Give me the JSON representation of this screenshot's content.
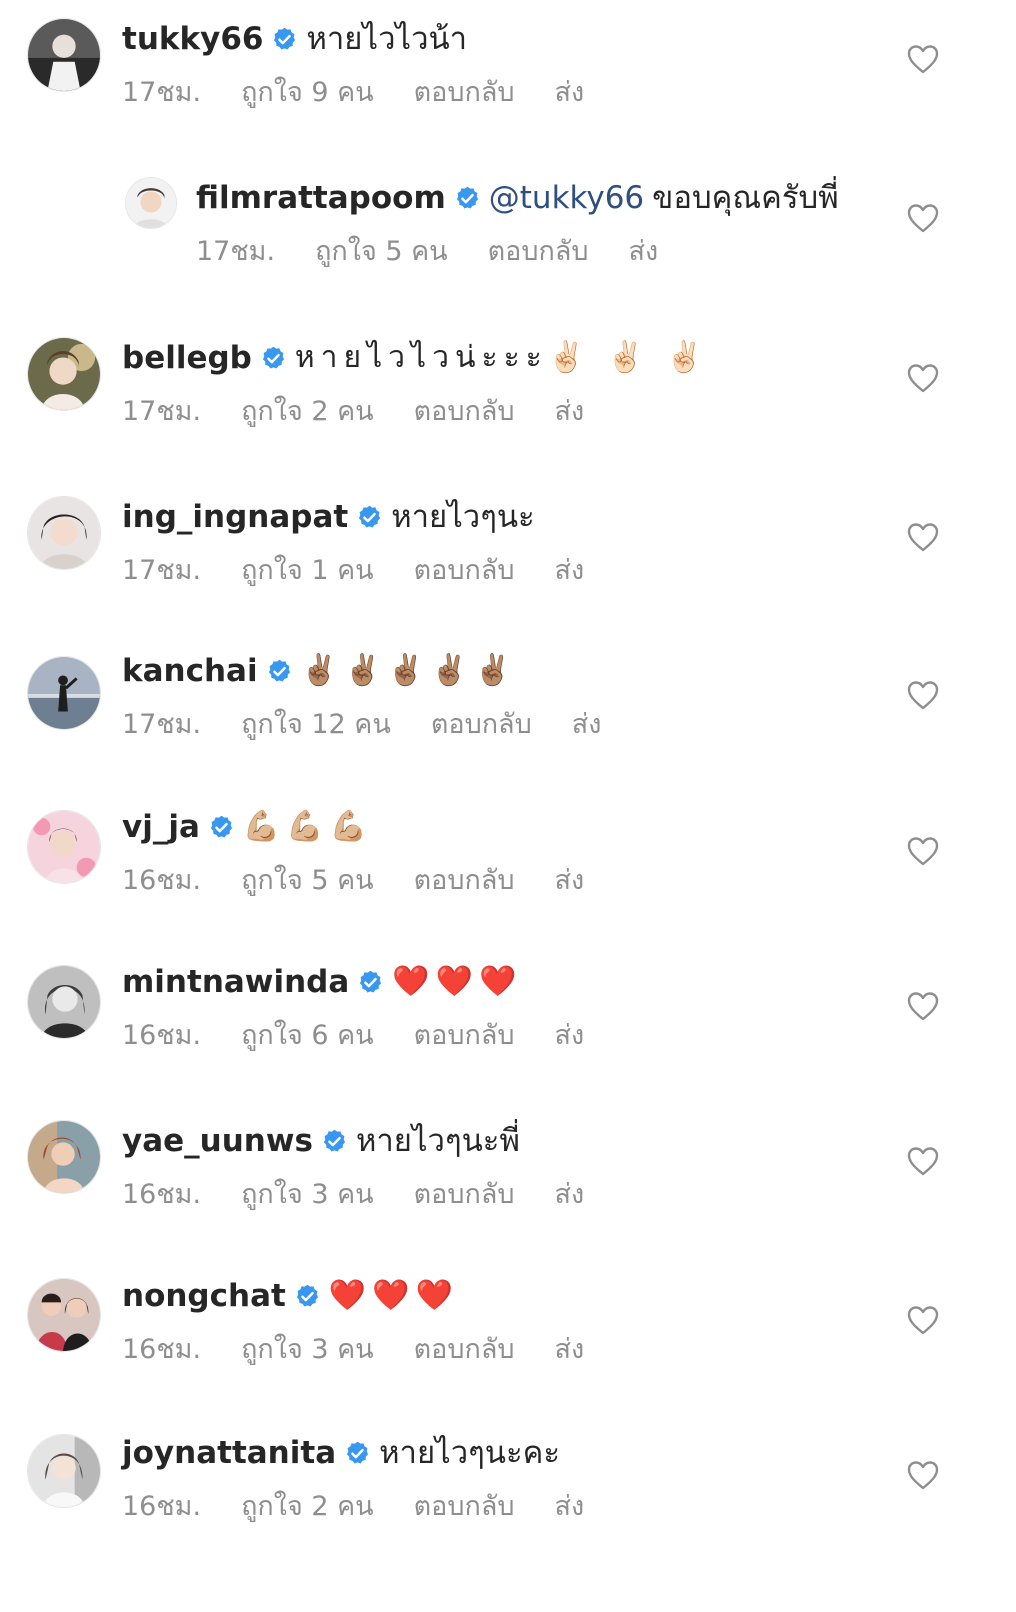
{
  "comments": [
    {
      "username": "tukky66",
      "mention": "",
      "text": "หายไวไวน้า",
      "time": "17ชม.",
      "likes": "ถูกใจ 9 คน",
      "reply": "ตอบกลับ",
      "send": "ส่ง"
    },
    {
      "username": "filmrattapoom",
      "mention": "@tukky66",
      "text": "ขอบคุณครับพี่",
      "time": "17ชม.",
      "likes": "ถูกใจ 5 คน",
      "reply": "ตอบกลับ",
      "send": "ส่ง"
    },
    {
      "username": "bellegb",
      "mention": "",
      "text": "หายไวไวน่ะะะ✌🏻 ✌🏻 ✌🏻",
      "time": "17ชม.",
      "likes": "ถูกใจ 2 คน",
      "reply": "ตอบกลับ",
      "send": "ส่ง"
    },
    {
      "username": "ing_ingnapat",
      "mention": "",
      "text": "หายไวๆนะ",
      "time": "17ชม.",
      "likes": "ถูกใจ 1 คน",
      "reply": "ตอบกลับ",
      "send": "ส่ง"
    },
    {
      "username": "kanchai",
      "mention": "",
      "text": "✌🏽✌🏽✌🏽✌🏽✌🏽",
      "time": "17ชม.",
      "likes": "ถูกใจ 12 คน",
      "reply": "ตอบกลับ",
      "send": "ส่ง"
    },
    {
      "username": "vj_ja",
      "mention": "",
      "text": "💪🏼💪🏼💪🏼",
      "time": "16ชม.",
      "likes": "ถูกใจ 5 คน",
      "reply": "ตอบกลับ",
      "send": "ส่ง"
    },
    {
      "username": "mintnawinda",
      "mention": "",
      "text": "❤️❤️❤️",
      "time": "16ชม.",
      "likes": "ถูกใจ 6 คน",
      "reply": "ตอบกลับ",
      "send": "ส่ง"
    },
    {
      "username": "yae_uunws",
      "mention": "",
      "text": "หายไวๆนะพี่",
      "time": "16ชม.",
      "likes": "ถูกใจ 3 คน",
      "reply": "ตอบกลับ",
      "send": "ส่ง"
    },
    {
      "username": "nongchat",
      "mention": "",
      "text": "❤️❤️❤️",
      "time": "16ชม.",
      "likes": "ถูกใจ 3 คน",
      "reply": "ตอบกลับ",
      "send": "ส่ง"
    },
    {
      "username": "joynattanita",
      "mention": "",
      "text": "หายไวๆนะคะ",
      "time": "16ชม.",
      "likes": "ถูกใจ 2 คน",
      "reply": "ตอบกลับ",
      "send": "ส่ง"
    }
  ],
  "colors": {
    "verified": "#3897f0",
    "meta": "#8e8e8e",
    "mention": "#2f4f7f",
    "text": "#262626"
  },
  "icons": {
    "like": "heart-outline-icon",
    "verified": "verified-badge-icon"
  }
}
